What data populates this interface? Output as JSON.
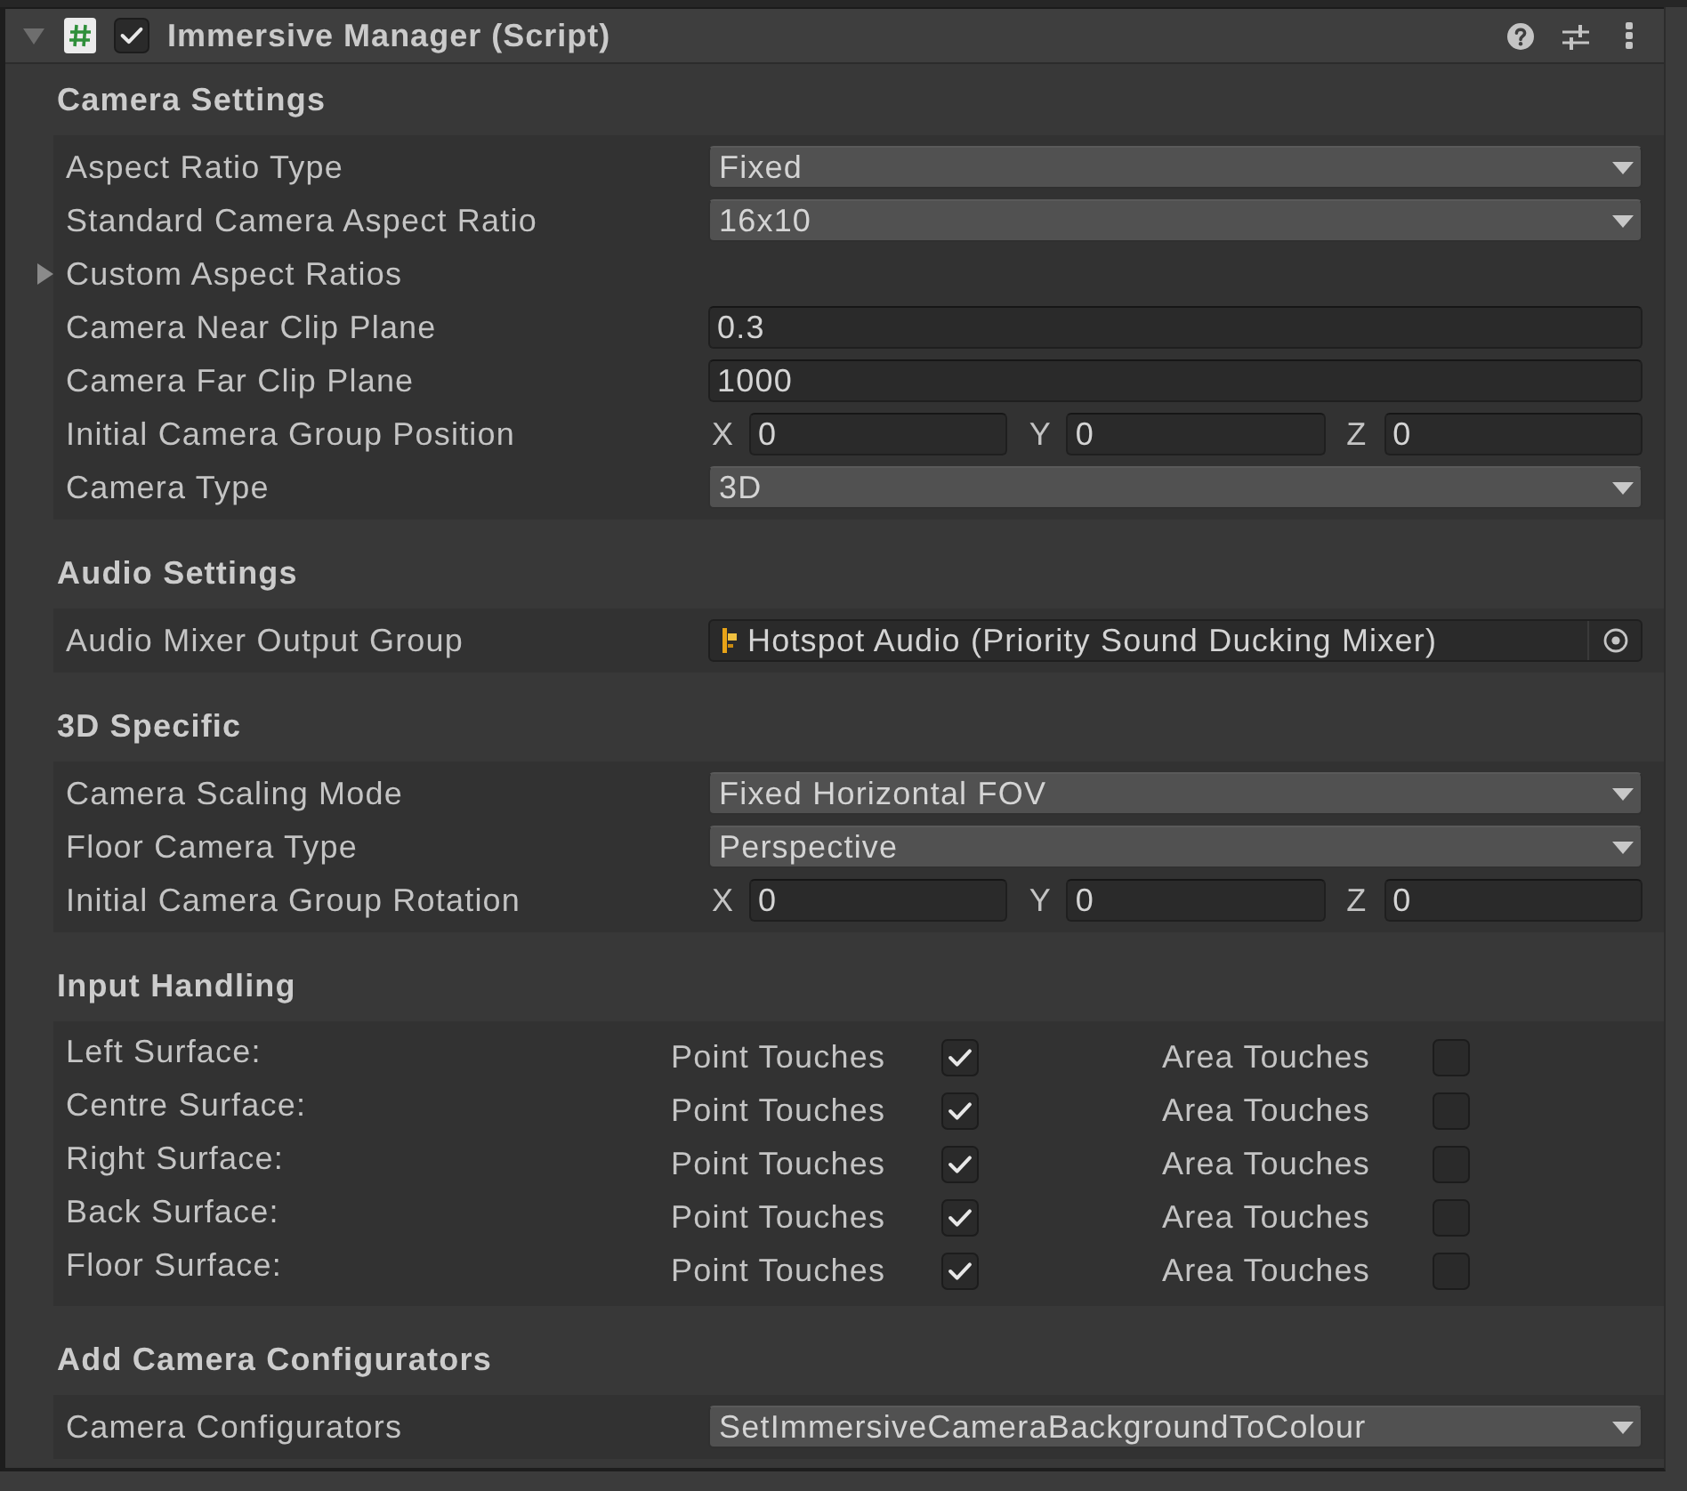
{
  "component": {
    "title": "Immersive Manager (Script)",
    "expanded": true,
    "enabled": true
  },
  "sections": [
    {
      "title": "Camera Settings",
      "rows": [
        {
          "kind": "dropdown",
          "label": "Aspect Ratio Type",
          "value": "Fixed"
        },
        {
          "kind": "dropdown",
          "label": "Standard Camera Aspect Ratio",
          "value": "16x10"
        },
        {
          "kind": "foldout",
          "label": "Custom Aspect Ratios",
          "expanded": false
        },
        {
          "kind": "text",
          "label": "Camera Near Clip Plane",
          "value": "0.3"
        },
        {
          "kind": "text",
          "label": "Camera Far Clip Plane",
          "value": "1000"
        },
        {
          "kind": "vector3",
          "label": "Initial Camera Group Position",
          "components": [
            {
              "axis": "X",
              "value": "0"
            },
            {
              "axis": "Y",
              "value": "0"
            },
            {
              "axis": "Z",
              "value": "0"
            }
          ]
        },
        {
          "kind": "dropdown",
          "label": "Camera Type",
          "value": "3D"
        }
      ]
    },
    {
      "title": "Audio Settings",
      "rows": [
        {
          "kind": "object",
          "label": "Audio Mixer Output Group",
          "value": "Hotspot Audio (Priority Sound Ducking Mixer)"
        }
      ]
    },
    {
      "title": "3D Specific",
      "rows": [
        {
          "kind": "dropdown",
          "label": "Camera Scaling Mode",
          "value": "Fixed Horizontal FOV"
        },
        {
          "kind": "dropdown",
          "label": "Floor Camera Type",
          "value": "Perspective"
        },
        {
          "kind": "vector3",
          "label": "Initial Camera Group Rotation",
          "components": [
            {
              "axis": "X",
              "value": "0"
            },
            {
              "axis": "Y",
              "value": "0"
            },
            {
              "axis": "Z",
              "value": "0"
            }
          ]
        }
      ]
    },
    {
      "title": "Input Handling",
      "rows": [
        {
          "kind": "toggles",
          "label": "Left Surface:",
          "toggles": [
            {
              "label": "Point Touches",
              "checked": true
            },
            {
              "label": "Area Touches",
              "checked": false
            }
          ]
        },
        {
          "kind": "toggles",
          "label": "Centre Surface:",
          "toggles": [
            {
              "label": "Point Touches",
              "checked": true
            },
            {
              "label": "Area Touches",
              "checked": false
            }
          ]
        },
        {
          "kind": "toggles",
          "label": "Right Surface:",
          "toggles": [
            {
              "label": "Point Touches",
              "checked": true
            },
            {
              "label": "Area Touches",
              "checked": false
            }
          ]
        },
        {
          "kind": "toggles",
          "label": "Back Surface:",
          "toggles": [
            {
              "label": "Point Touches",
              "checked": true
            },
            {
              "label": "Area Touches",
              "checked": false
            }
          ]
        },
        {
          "kind": "toggles",
          "label": "Floor Surface:",
          "toggles": [
            {
              "label": "Point Touches",
              "checked": true
            },
            {
              "label": "Area Touches",
              "checked": false
            }
          ]
        }
      ]
    },
    {
      "title": "Add Camera Configurators",
      "rows": [
        {
          "kind": "dropdown",
          "label": "Camera Configurators",
          "value": "SetImmersiveCameraBackgroundToColour"
        }
      ]
    }
  ]
}
